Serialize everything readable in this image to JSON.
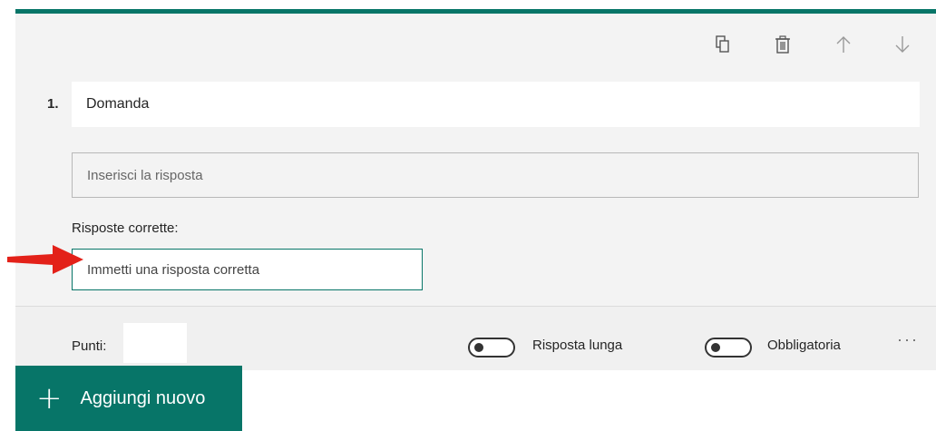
{
  "toolbar": {
    "icons": [
      "copy-icon",
      "trash-icon",
      "arrow-up-icon",
      "arrow-down-icon"
    ]
  },
  "question": {
    "number": "1.",
    "title": "Domanda",
    "answer_placeholder": "Inserisci la risposta"
  },
  "correct_answers": {
    "label": "Risposte corrette:",
    "placeholder": "Immetti una risposta corretta"
  },
  "footer": {
    "points_label": "Punti:",
    "points_value": "",
    "long_answer_label": "Risposta lunga",
    "required_label": "Obbligatoria",
    "more_label": "···"
  },
  "add_button": {
    "label": "Aggiungi nuovo"
  },
  "colors": {
    "accent": "#077568",
    "card_bg": "#f3f3f3",
    "annotation_arrow": "#e32119"
  }
}
